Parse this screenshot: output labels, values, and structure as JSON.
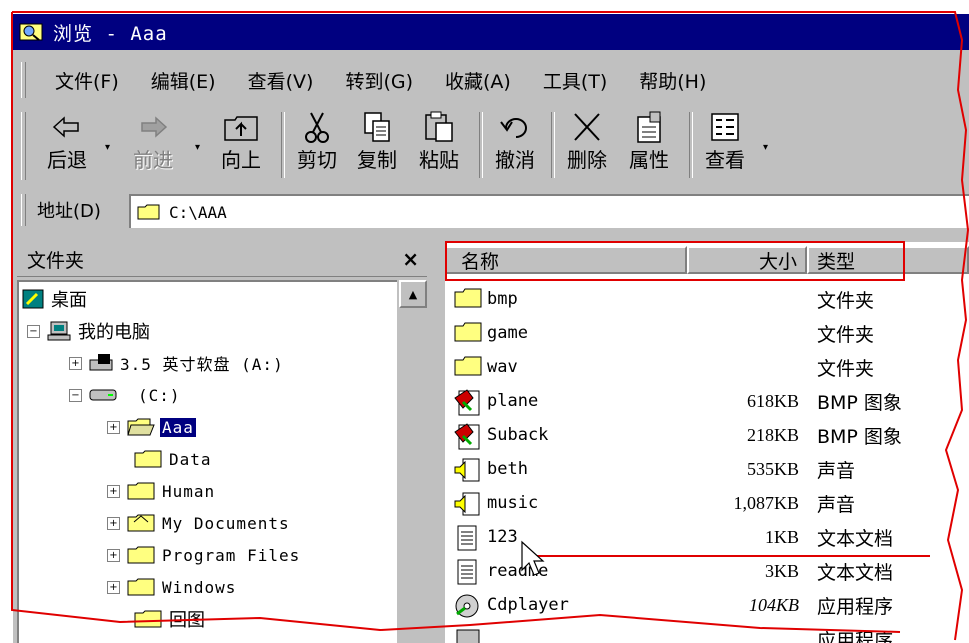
{
  "window": {
    "title": "浏览 - Aaa"
  },
  "menu": {
    "items": [
      "文件(F)",
      "编辑(E)",
      "查看(V)",
      "转到(G)",
      "收藏(A)",
      "工具(T)",
      "帮助(H)"
    ]
  },
  "toolbar": {
    "back": "后退",
    "forward": "前进",
    "up": "向上",
    "cut": "剪切",
    "copy": "复制",
    "paste": "粘贴",
    "undo": "撤消",
    "delete": "删除",
    "properties": "属性",
    "views": "查看"
  },
  "address": {
    "label": "地址(D)",
    "value": "C:\\AAA"
  },
  "folders": {
    "title": "文件夹",
    "close": "×",
    "tree": [
      {
        "label": "桌面"
      },
      {
        "label": "我的电脑"
      },
      {
        "label": "3.5 英寸软盘 (A:)"
      },
      {
        "label": "(C:)"
      },
      {
        "label": "Aaa"
      },
      {
        "label": "Data"
      },
      {
        "label": "Human"
      },
      {
        "label": "My Documents"
      },
      {
        "label": "Program Files"
      },
      {
        "label": "Windows"
      },
      {
        "label": "回图"
      }
    ]
  },
  "files": {
    "columns": {
      "name": "名称",
      "size": "大小",
      "type": "类型"
    },
    "rows": [
      {
        "name": "bmp",
        "size": "",
        "type": "文件夹",
        "icon": "folder-icon"
      },
      {
        "name": "game",
        "size": "",
        "type": "文件夹",
        "icon": "folder-icon"
      },
      {
        "name": "wav",
        "size": "",
        "type": "文件夹",
        "icon": "folder-icon"
      },
      {
        "name": "plane",
        "size": "618KB",
        "type": "BMP 图象",
        "icon": "bitmap-icon"
      },
      {
        "name": "Suback",
        "size": "218KB",
        "type": "BMP 图象",
        "icon": "bitmap-icon"
      },
      {
        "name": "beth",
        "size": "535KB",
        "type": "声音",
        "icon": "sound-icon"
      },
      {
        "name": "music",
        "size": "1,087KB",
        "type": "声音",
        "icon": "sound-icon"
      },
      {
        "name": "123",
        "size": "1KB",
        "type": "文本文档",
        "icon": "text-document-icon"
      },
      {
        "name": "readme",
        "size": "3KB",
        "type": "文本文档",
        "icon": "text-document-icon"
      },
      {
        "name": "Cdplayer",
        "size": "104KB",
        "type": "应用程序",
        "icon": "cd-player-icon"
      },
      {
        "name": "",
        "size": "",
        "type": "应用程序",
        "icon": "application-icon"
      }
    ]
  },
  "colors": {
    "titlebar": "#000080",
    "face": "#c0c0c0",
    "annotation": "#e00000"
  }
}
